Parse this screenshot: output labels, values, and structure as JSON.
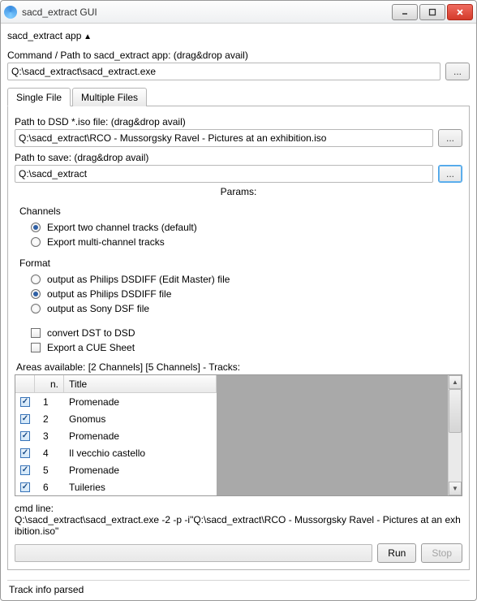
{
  "window": {
    "title": "sacd_extract GUI"
  },
  "app_section": "sacd_extract app",
  "command": {
    "label": "Command / Path to sacd_extract app: (drag&drop avail)",
    "value": "Q:\\sacd_extract\\sacd_extract.exe",
    "browse": "..."
  },
  "tabs": {
    "single": "Single File",
    "multiple": "Multiple Files"
  },
  "iso": {
    "label": "Path to DSD *.iso file: (drag&drop avail)",
    "value": "Q:\\sacd_extract\\RCO - Mussorgsky Ravel - Pictures at an exhibition.iso",
    "browse": "..."
  },
  "save": {
    "label": "Path to save: (drag&drop avail)",
    "value": "Q:\\sacd_extract",
    "browse": "..."
  },
  "params_title": "Params:",
  "channels": {
    "title": "Channels",
    "two": "Export two channel tracks (default)",
    "multi": "Export multi-channel tracks"
  },
  "format": {
    "title": "Format",
    "dsdiff_em": "output as Philips DSDIFF (Edit Master) file",
    "dsdiff": "output as Philips DSDIFF file",
    "dsf": "output as Sony DSF file"
  },
  "extras": {
    "dst": "convert DST to DSD",
    "cue": "Export a CUE Sheet"
  },
  "areas_label": "Areas available: [2 Channels] [5 Channels] - Tracks:",
  "table": {
    "col_n": "n.",
    "col_title": "Title",
    "rows": [
      {
        "n": "1",
        "title": "Promenade"
      },
      {
        "n": "2",
        "title": "Gnomus"
      },
      {
        "n": "3",
        "title": "Promenade"
      },
      {
        "n": "4",
        "title": "Il vecchio castello"
      },
      {
        "n": "5",
        "title": "Promenade"
      },
      {
        "n": "6",
        "title": "Tuileries"
      }
    ]
  },
  "cmd": {
    "label": "cmd line:",
    "text": "Q:\\sacd_extract\\sacd_extract.exe -2 -p  -i\"Q:\\sacd_extract\\RCO - Mussorgsky Ravel - Pictures at an exhibition.iso\""
  },
  "buttons": {
    "run": "Run",
    "stop": "Stop"
  },
  "status": "Track info parsed"
}
